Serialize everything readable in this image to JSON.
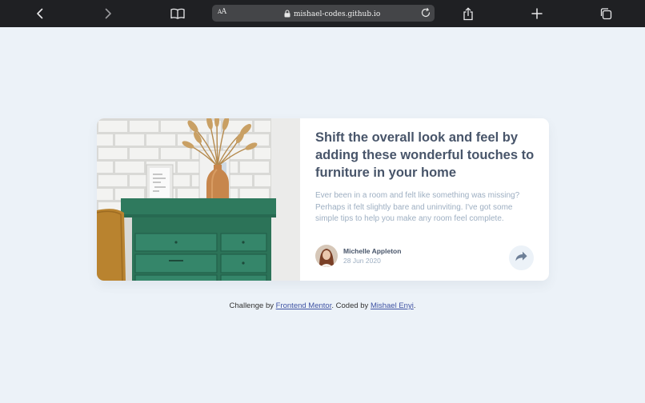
{
  "browser": {
    "url": "mishael-codes.github.io",
    "reader_label": "AA",
    "icons": {
      "back": "chevron-left-icon",
      "forward": "chevron-right-icon",
      "bookmarks": "book-icon",
      "lock": "lock-icon",
      "reload": "reload-icon",
      "share": "share-icon",
      "new_tab": "plus-icon",
      "tabs": "tabs-icon"
    }
  },
  "card": {
    "headline": "Shift the overall look and feel by adding these wonderful touches to furniture in your home",
    "excerpt": "Ever been in a room and felt like something was missing? Perhaps it felt slightly bare and uninviting. I've got some simple tips to help you make any room feel complete.",
    "author": {
      "name": "Michelle Appleton",
      "date": "28 Jun 2020"
    },
    "share_icon": "share-arrow-icon"
  },
  "attribution": {
    "prefix": "Challenge by ",
    "link1": "Frontend Mentor",
    "middle": ". Coded by ",
    "link2": "Mishael Enyi",
    "suffix": "."
  },
  "colors": {
    "page_background": "#ecf2f8",
    "heading": "#48556a",
    "muted_text": "#9eafc2",
    "link": "#3e52a3",
    "drawer_green": "#2f7a5e"
  }
}
